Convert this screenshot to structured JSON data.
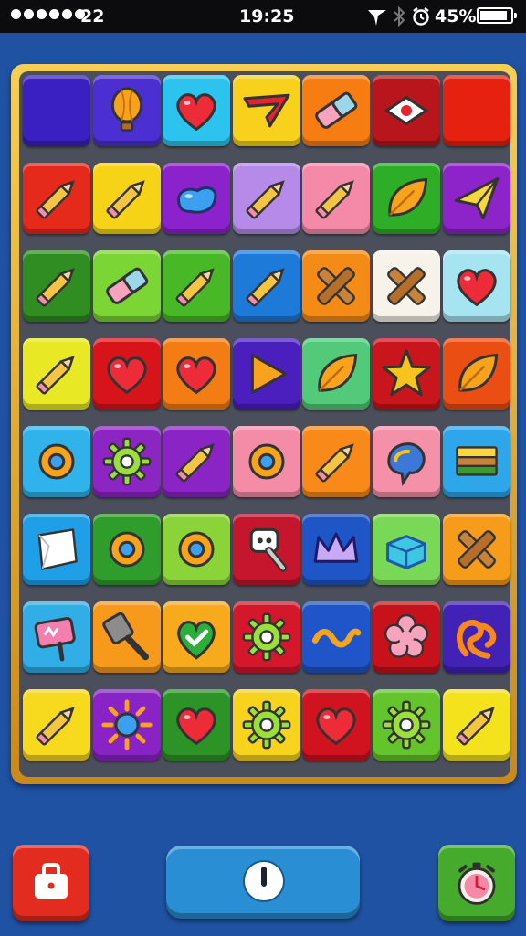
{
  "status_bar": {
    "signal_dots": 6,
    "carrier": "22",
    "time": "19:25",
    "battery_percent": "45%",
    "battery_level": 0.9
  },
  "board": {
    "rows": [
      [
        {
          "color": "#3a1fc2",
          "icon": "blank"
        },
        {
          "color": "#4b2fd3",
          "icon": "balloon"
        },
        {
          "color": "#2cc4ee",
          "icon": "heart"
        },
        {
          "color": "#f7d11c",
          "icon": "boomerang"
        },
        {
          "color": "#f77d13",
          "icon": "eraser"
        },
        {
          "color": "#b8161c",
          "icon": "diamond-sign"
        },
        {
          "color": "#e7210f",
          "icon": "blank"
        }
      ],
      [
        {
          "color": "#e52a1c",
          "icon": "pencil"
        },
        {
          "color": "#f6d317",
          "icon": "pencil"
        },
        {
          "color": "#8c22cc",
          "icon": "blob"
        },
        {
          "color": "#b58ae8",
          "icon": "pencil"
        },
        {
          "color": "#f48aa8",
          "icon": "pencil"
        },
        {
          "color": "#2ead26",
          "icon": "leaf"
        },
        {
          "color": "#8d24c9",
          "icon": "paper-plane"
        }
      ],
      [
        {
          "color": "#2f8d22",
          "icon": "pencil"
        },
        {
          "color": "#7bd534",
          "icon": "eraser"
        },
        {
          "color": "#49b826",
          "icon": "pencil"
        },
        {
          "color": "#1e7ad9",
          "icon": "pencil"
        },
        {
          "color": "#f58b17",
          "icon": "cross"
        },
        {
          "color": "#f7f3ea",
          "icon": "cross"
        },
        {
          "color": "#a7e4f1",
          "icon": "heart"
        }
      ],
      [
        {
          "color": "#e9e824",
          "icon": "pencil"
        },
        {
          "color": "#d8141b",
          "icon": "heart"
        },
        {
          "color": "#f37c15",
          "icon": "heart"
        },
        {
          "color": "#4a1fbe",
          "icon": "triangle"
        },
        {
          "color": "#53c97a",
          "icon": "leaf"
        },
        {
          "color": "#c9151c",
          "icon": "star"
        },
        {
          "color": "#ea4e13",
          "icon": "leaf"
        }
      ],
      [
        {
          "color": "#30b3ea",
          "icon": "ring"
        },
        {
          "color": "#8c26c3",
          "icon": "gear"
        },
        {
          "color": "#8a24c4",
          "icon": "pencil"
        },
        {
          "color": "#f48ca8",
          "icon": "ring"
        },
        {
          "color": "#f98a19",
          "icon": "pencil"
        },
        {
          "color": "#f490a8",
          "icon": "bubble"
        },
        {
          "color": "#2da6ea",
          "icon": "blocks"
        }
      ],
      [
        {
          "color": "#1f9fe8",
          "icon": "paper"
        },
        {
          "color": "#2f9d2c",
          "icon": "ring"
        },
        {
          "color": "#8ad43a",
          "icon": "ring"
        },
        {
          "color": "#c5162d",
          "icon": "key"
        },
        {
          "color": "#1f56c7",
          "icon": "crown"
        },
        {
          "color": "#7ad857",
          "icon": "cube"
        },
        {
          "color": "#f69b1a",
          "icon": "cross"
        }
      ],
      [
        {
          "color": "#31aee8",
          "icon": "sign"
        },
        {
          "color": "#f79a1b",
          "icon": "spatula"
        },
        {
          "color": "#f6aa1c",
          "icon": "heart-check"
        },
        {
          "color": "#d5172b",
          "icon": "gear"
        },
        {
          "color": "#1f55c8",
          "icon": "wave"
        },
        {
          "color": "#c7121b",
          "icon": "flower"
        },
        {
          "color": "#4121b6",
          "icon": "pretzel"
        }
      ],
      [
        {
          "color": "#f7d91d",
          "icon": "pencil"
        },
        {
          "color": "#8a23c6",
          "icon": "sun"
        },
        {
          "color": "#2c9326",
          "icon": "heart"
        },
        {
          "color": "#f8d31d",
          "icon": "gear"
        },
        {
          "color": "#d0131f",
          "icon": "heart"
        },
        {
          "color": "#63c42c",
          "icon": "gear"
        },
        {
          "color": "#f3e21c",
          "icon": "pencil"
        }
      ]
    ]
  },
  "controls": {
    "left": {
      "color": "#e22c20",
      "icon": "bag"
    },
    "center": {
      "color": "#2a8ed4",
      "icon": "power"
    },
    "right": {
      "color": "#46aa2c",
      "icon": "timer"
    }
  }
}
